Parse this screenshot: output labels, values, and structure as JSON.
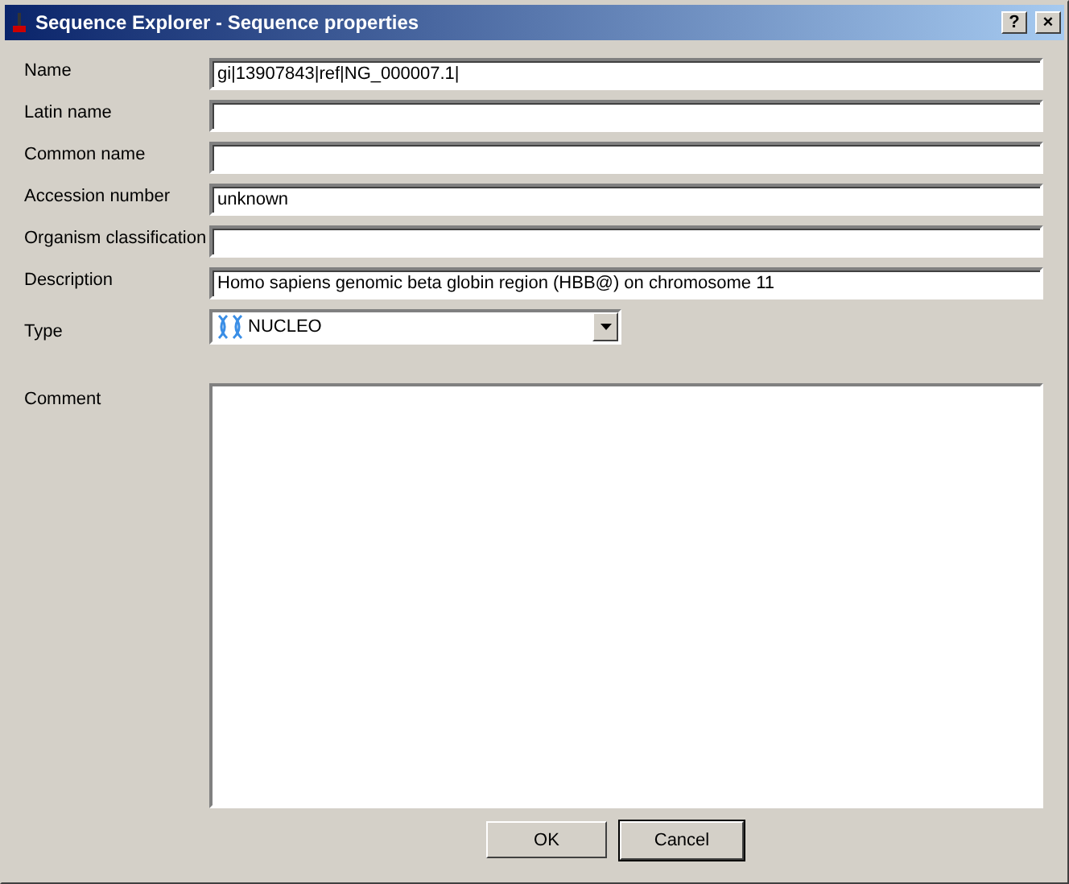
{
  "window": {
    "title": "Sequence Explorer - Sequence properties"
  },
  "title_buttons": [
    "?",
    "×"
  ],
  "fields": [
    {
      "label": "Name",
      "value": "gi|13907843|ref|NG_000007.1|"
    },
    {
      "label": "Latin name"
    },
    {
      "label": "Common name"
    },
    {
      "label": "Accession number",
      "value": "unknown"
    },
    {
      "label": "Organism classification"
    },
    {
      "label": "Description",
      "value": "Homo sapiens genomic beta globin region (HBB@) on chromosome 11"
    }
  ],
  "type": {
    "label": "Type",
    "value": "NUCLEO"
  },
  "comment": {
    "label": "Comment"
  },
  "buttons": [
    {
      "label": "OK",
      "default": false
    },
    {
      "label": "Cancel",
      "default": true
    }
  ]
}
